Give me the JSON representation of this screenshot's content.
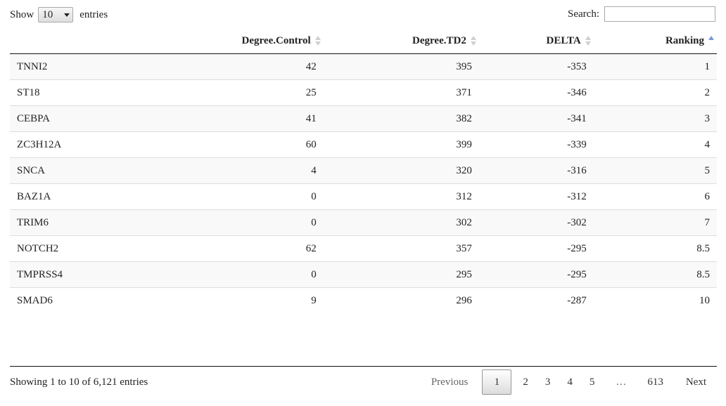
{
  "length_menu": {
    "show_label": "Show",
    "selected": "10",
    "entries_label": "entries"
  },
  "search": {
    "label": "Search:",
    "value": ""
  },
  "table": {
    "columns": [
      "",
      "Degree.Control",
      "Degree.TD2",
      "DELTA",
      "Ranking"
    ],
    "sort": {
      "column": "Ranking",
      "direction": "asc"
    },
    "rows": [
      [
        "TNNI2",
        "42",
        "395",
        "-353",
        "1"
      ],
      [
        "ST18",
        "25",
        "371",
        "-346",
        "2"
      ],
      [
        "CEBPA",
        "41",
        "382",
        "-341",
        "3"
      ],
      [
        "ZC3H12A",
        "60",
        "399",
        "-339",
        "4"
      ],
      [
        "SNCA",
        "4",
        "320",
        "-316",
        "5"
      ],
      [
        "BAZ1A",
        "0",
        "312",
        "-312",
        "6"
      ],
      [
        "TRIM6",
        "0",
        "302",
        "-302",
        "7"
      ],
      [
        "NOTCH2",
        "62",
        "357",
        "-295",
        "8.5"
      ],
      [
        "TMPRSS4",
        "0",
        "295",
        "-295",
        "8.5"
      ],
      [
        "SMAD6",
        "9",
        "296",
        "-287",
        "10"
      ]
    ]
  },
  "footer": {
    "info": "Showing 1 to 10 of 6,121 entries",
    "pagination": {
      "previous": "Previous",
      "pages": [
        "1",
        "2",
        "3",
        "4",
        "5",
        "…",
        "613"
      ],
      "current": "1",
      "next": "Next"
    }
  }
}
